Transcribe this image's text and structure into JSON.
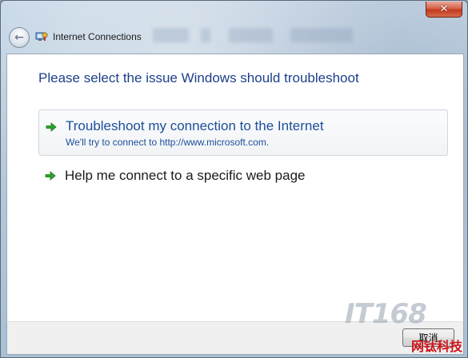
{
  "window": {
    "title": "Internet Connections",
    "close_glyph": "✕",
    "back_glyph": "←",
    "app_icon": "network-troubleshooter-icon"
  },
  "main": {
    "instruction": "Please select the issue Windows should troubleshoot",
    "options": [
      {
        "title": "Troubleshoot my connection to the Internet",
        "subtitle": "We'll try to connect to http://www.microsoft.com.",
        "icon": "green-arrow-icon",
        "selected": true
      },
      {
        "title": "Help me connect to a specific web page",
        "icon": "green-arrow-icon",
        "selected": false
      }
    ]
  },
  "footer": {
    "cancel_label": "取消"
  },
  "watermark": {
    "logo_text": "IT168",
    "cn_text": "网钛科技"
  },
  "colors": {
    "accent_blue": "#1c4f9c",
    "heading_blue": "#1e3f8a",
    "arrow_green": "#2aa52a",
    "watermark_red": "#d0141a"
  }
}
